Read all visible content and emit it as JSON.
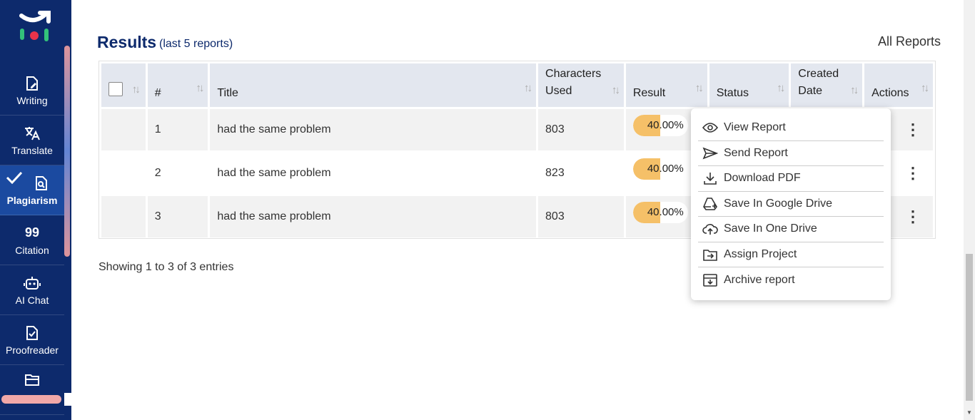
{
  "sidebar": {
    "items": [
      {
        "label": "Writing",
        "icon": "writing-icon"
      },
      {
        "label": "Translate",
        "icon": "translate-icon"
      },
      {
        "label": "Plagiarism",
        "icon": "plagiarism-icon",
        "active": true
      },
      {
        "label": "Citation",
        "icon": "citation-icon",
        "glyph": "99"
      },
      {
        "label": "AI Chat",
        "icon": "robot-icon"
      },
      {
        "label": "Proofreader",
        "icon": "proofreader-icon"
      },
      {
        "label": "",
        "icon": "folder-icon"
      }
    ]
  },
  "header": {
    "title": "Results",
    "subtitle": "(last 5 reports)",
    "all_reports": "All Reports"
  },
  "table": {
    "columns": [
      "#",
      "Title",
      "Characters Used",
      "Result",
      "Status",
      "Created Date",
      "Actions"
    ],
    "col_chars_line1": "Characters",
    "col_chars_line2": "Used",
    "col_created_line1": "Created",
    "col_created_line2": "Date",
    "rows": [
      {
        "num": "1",
        "title": "had the same problem",
        "chars": "803",
        "result": "40.00%"
      },
      {
        "num": "2",
        "title": "had the same problem",
        "chars": "823",
        "result": "40.00%"
      },
      {
        "num": "3",
        "title": "had the same problem",
        "chars": "803",
        "result": "40.00%"
      }
    ]
  },
  "footer": {
    "showing": "Showing 1 to 3 of 3 entries"
  },
  "menu": {
    "items": [
      {
        "label": "View Report",
        "icon": "eye-icon"
      },
      {
        "label": "Send Report",
        "icon": "send-icon"
      },
      {
        "label": "Download PDF",
        "icon": "download-icon"
      },
      {
        "label": "Save In Google Drive",
        "icon": "google-drive-icon"
      },
      {
        "label": "Save In One Drive",
        "icon": "cloud-upload-icon"
      },
      {
        "label": "Assign Project",
        "icon": "assign-icon"
      },
      {
        "label": "Archive report",
        "icon": "archive-icon"
      }
    ]
  },
  "colors": {
    "sidebar": "#0d2a6c",
    "accent": "#0d2a6c",
    "pill": "#f5c068"
  }
}
